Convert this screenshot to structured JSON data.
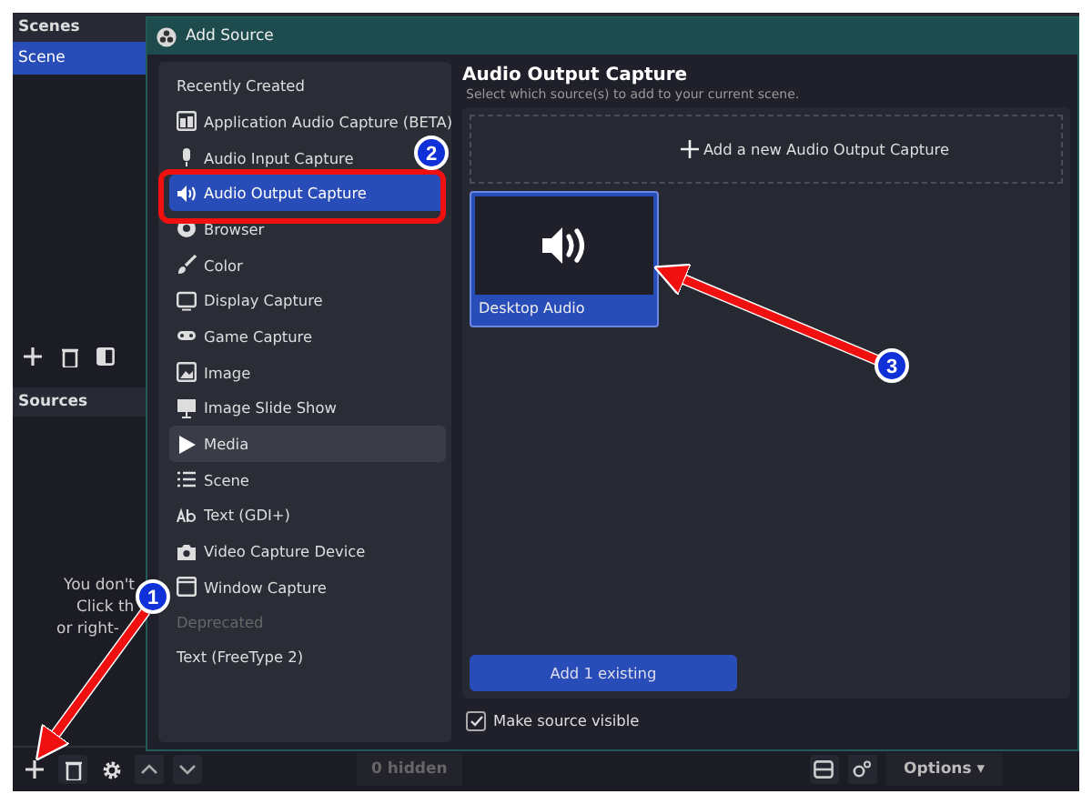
{
  "main": {
    "scenes_title": "Scenes",
    "scenes": [
      {
        "label": "Scene",
        "selected": true
      }
    ],
    "sources_title": "Sources",
    "sources_hint": [
      "You don't",
      "Click th",
      "or right-"
    ],
    "hidden_count": "0 hidden",
    "options_button": "Options ▾"
  },
  "dialog": {
    "title": "Add Source",
    "list": [
      {
        "kind": "header",
        "label": "Recently Created",
        "disabled": false
      },
      {
        "kind": "item",
        "label": "Application Audio Capture (BETA)",
        "selected": false,
        "highlighted": false
      },
      {
        "kind": "item",
        "label": "Audio Input Capture",
        "selected": false,
        "highlighted": false
      },
      {
        "kind": "item",
        "label": "Audio Output Capture",
        "selected": true,
        "highlighted": false
      },
      {
        "kind": "item",
        "label": "Browser",
        "selected": false,
        "highlighted": false
      },
      {
        "kind": "item",
        "label": "Color",
        "selected": false,
        "highlighted": false
      },
      {
        "kind": "item",
        "label": "Display Capture",
        "selected": false,
        "highlighted": false
      },
      {
        "kind": "item",
        "label": "Game Capture",
        "selected": false,
        "highlighted": false
      },
      {
        "kind": "item",
        "label": "Image",
        "selected": false,
        "highlighted": false
      },
      {
        "kind": "item",
        "label": "Image Slide Show",
        "selected": false,
        "highlighted": false
      },
      {
        "kind": "item",
        "label": "Media",
        "selected": false,
        "highlighted": true
      },
      {
        "kind": "item",
        "label": "Scene",
        "selected": false,
        "highlighted": false
      },
      {
        "kind": "item",
        "label": "Text (GDI+)",
        "selected": false,
        "highlighted": false
      },
      {
        "kind": "item",
        "label": "Video Capture Device",
        "selected": false,
        "highlighted": false
      },
      {
        "kind": "item",
        "label": "Window Capture",
        "selected": false,
        "highlighted": false
      },
      {
        "kind": "header",
        "label": "Deprecated",
        "disabled": true
      },
      {
        "kind": "plain",
        "label": "Text (FreeType 2)",
        "selected": false,
        "highlighted": false
      }
    ],
    "heading": "Audio Output Capture",
    "subheading": "Select which source(s) to add to your current scene.",
    "add_new": "Add a new Audio Output Capture",
    "existing": [
      {
        "label": "Desktop Audio",
        "selected": true
      }
    ],
    "add_existing_button": "Add 1 existing",
    "make_visible": {
      "label": "Make source visible",
      "checked": true
    }
  },
  "annotations": [
    {
      "number": "1"
    },
    {
      "number": "2"
    },
    {
      "number": "3"
    }
  ]
}
